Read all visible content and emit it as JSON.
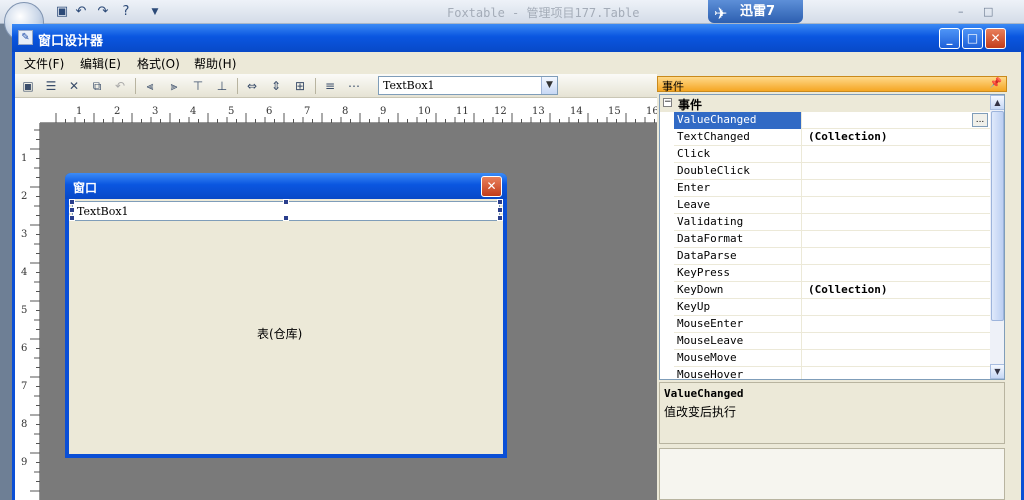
{
  "app": {
    "title": "Foxtable - 管理项目177.Table",
    "quick_access": [
      "save-icon",
      "undo-icon",
      "redo-icon",
      "help-icon",
      "dropdown-icon"
    ],
    "xunlei_label": "迅雷7",
    "controls": [
      "–",
      "□"
    ]
  },
  "designer": {
    "title": "窗口设计器",
    "controls": {
      "min": "_",
      "max": "□",
      "close": "✕"
    },
    "menu": [
      "文件(F)",
      "编辑(E)",
      "格式(O)",
      "帮助(H)"
    ],
    "combo_value": "TextBox1"
  },
  "ruler": {
    "top": [
      "1",
      "2",
      "3",
      "4",
      "5",
      "6",
      "7",
      "8",
      "9",
      "10",
      "11",
      "12",
      "13",
      "14",
      "15",
      "16"
    ],
    "left": [
      "1",
      "2",
      "3",
      "4",
      "5",
      "6",
      "7",
      "8",
      "9"
    ]
  },
  "form": {
    "title": "窗口",
    "close": "✕",
    "textbox_value": "TextBox1",
    "table_label": "表(仓库)"
  },
  "properties": {
    "header": "事件",
    "category": "事件",
    "rows": [
      {
        "name": "ValueChanged",
        "value": ""
      },
      {
        "name": "TextChanged",
        "value": "(Collection)"
      },
      {
        "name": "Click",
        "value": ""
      },
      {
        "name": "DoubleClick",
        "value": ""
      },
      {
        "name": "Enter",
        "value": ""
      },
      {
        "name": "Leave",
        "value": ""
      },
      {
        "name": "Validating",
        "value": ""
      },
      {
        "name": "DataFormat",
        "value": ""
      },
      {
        "name": "DataParse",
        "value": ""
      },
      {
        "name": "KeyPress",
        "value": ""
      },
      {
        "name": "KeyDown",
        "value": "(Collection)"
      },
      {
        "name": "KeyUp",
        "value": ""
      },
      {
        "name": "MouseEnter",
        "value": ""
      },
      {
        "name": "MouseLeave",
        "value": ""
      },
      {
        "name": "MouseMove",
        "value": ""
      },
      {
        "name": "MouseHover",
        "value": ""
      }
    ],
    "selected_row": "ValueChanged",
    "ellipsis": "...",
    "desc_name": "ValueChanged",
    "desc_text": "值改变后执行"
  },
  "colors": {
    "titlebar": "#0a4fd6",
    "selection": "#316ac5",
    "panel_header": "#f5a623"
  }
}
